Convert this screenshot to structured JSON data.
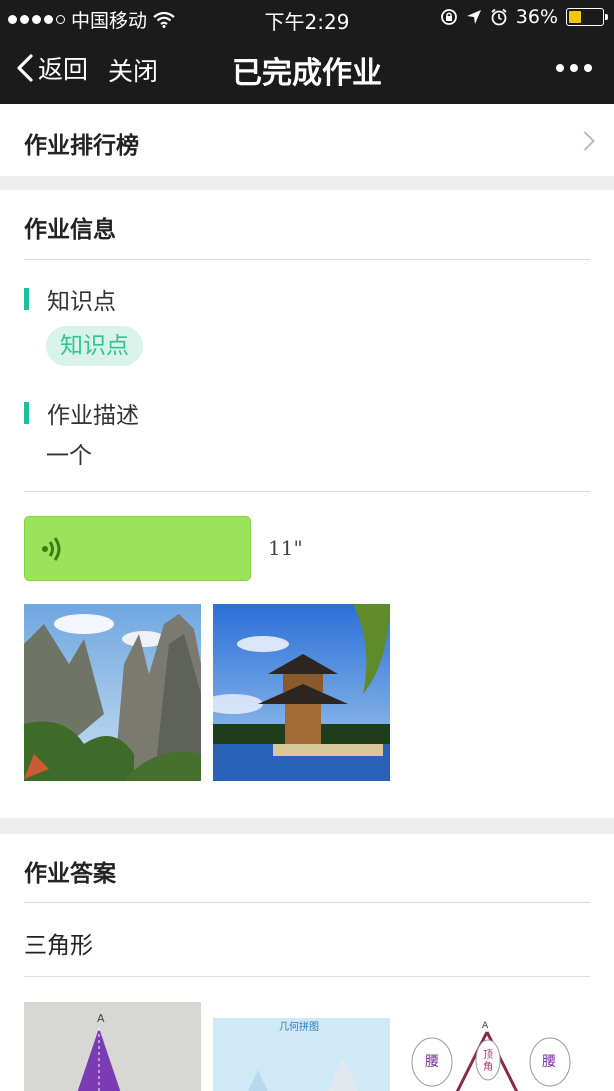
{
  "status_bar": {
    "carrier": "中国移动",
    "time": "下午2:29",
    "battery": "36%",
    "battery_level": 0.36
  },
  "nav": {
    "back_label": "返回",
    "close_label": "关闭",
    "title": "已完成作业"
  },
  "ranking": {
    "label": "作业排行榜"
  },
  "info": {
    "heading": "作业信息",
    "knowledge_title": "知识点",
    "knowledge_tag": "知识点",
    "description_title": "作业描述",
    "description_text": "一个",
    "voice_duration": "11\""
  },
  "answer": {
    "heading": "作业答案",
    "text": "三角形",
    "image2_caption": "几何拼图",
    "image3_left": "腰",
    "image3_mid": "顶角",
    "image3_right": "腰",
    "vertex_label": "A"
  },
  "colors": {
    "accent": "#1fbf9a",
    "tag_bg": "#d9f3ea",
    "voice_bg": "#9be35a",
    "nav_bg": "#1b1b1c"
  }
}
